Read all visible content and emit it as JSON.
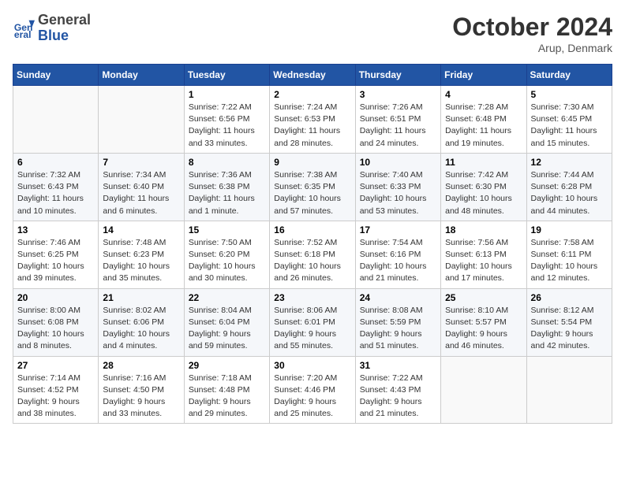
{
  "logo": {
    "line1": "General",
    "line2": "Blue"
  },
  "title": "October 2024",
  "subtitle": "Arup, Denmark",
  "days_of_week": [
    "Sunday",
    "Monday",
    "Tuesday",
    "Wednesday",
    "Thursday",
    "Friday",
    "Saturday"
  ],
  "weeks": [
    [
      {
        "day": "",
        "detail": ""
      },
      {
        "day": "",
        "detail": ""
      },
      {
        "day": "1",
        "detail": "Sunrise: 7:22 AM\nSunset: 6:56 PM\nDaylight: 11 hours\nand 33 minutes."
      },
      {
        "day": "2",
        "detail": "Sunrise: 7:24 AM\nSunset: 6:53 PM\nDaylight: 11 hours\nand 28 minutes."
      },
      {
        "day": "3",
        "detail": "Sunrise: 7:26 AM\nSunset: 6:51 PM\nDaylight: 11 hours\nand 24 minutes."
      },
      {
        "day": "4",
        "detail": "Sunrise: 7:28 AM\nSunset: 6:48 PM\nDaylight: 11 hours\nand 19 minutes."
      },
      {
        "day": "5",
        "detail": "Sunrise: 7:30 AM\nSunset: 6:45 PM\nDaylight: 11 hours\nand 15 minutes."
      }
    ],
    [
      {
        "day": "6",
        "detail": "Sunrise: 7:32 AM\nSunset: 6:43 PM\nDaylight: 11 hours\nand 10 minutes."
      },
      {
        "day": "7",
        "detail": "Sunrise: 7:34 AM\nSunset: 6:40 PM\nDaylight: 11 hours\nand 6 minutes."
      },
      {
        "day": "8",
        "detail": "Sunrise: 7:36 AM\nSunset: 6:38 PM\nDaylight: 11 hours\nand 1 minute."
      },
      {
        "day": "9",
        "detail": "Sunrise: 7:38 AM\nSunset: 6:35 PM\nDaylight: 10 hours\nand 57 minutes."
      },
      {
        "day": "10",
        "detail": "Sunrise: 7:40 AM\nSunset: 6:33 PM\nDaylight: 10 hours\nand 53 minutes."
      },
      {
        "day": "11",
        "detail": "Sunrise: 7:42 AM\nSunset: 6:30 PM\nDaylight: 10 hours\nand 48 minutes."
      },
      {
        "day": "12",
        "detail": "Sunrise: 7:44 AM\nSunset: 6:28 PM\nDaylight: 10 hours\nand 44 minutes."
      }
    ],
    [
      {
        "day": "13",
        "detail": "Sunrise: 7:46 AM\nSunset: 6:25 PM\nDaylight: 10 hours\nand 39 minutes."
      },
      {
        "day": "14",
        "detail": "Sunrise: 7:48 AM\nSunset: 6:23 PM\nDaylight: 10 hours\nand 35 minutes."
      },
      {
        "day": "15",
        "detail": "Sunrise: 7:50 AM\nSunset: 6:20 PM\nDaylight: 10 hours\nand 30 minutes."
      },
      {
        "day": "16",
        "detail": "Sunrise: 7:52 AM\nSunset: 6:18 PM\nDaylight: 10 hours\nand 26 minutes."
      },
      {
        "day": "17",
        "detail": "Sunrise: 7:54 AM\nSunset: 6:16 PM\nDaylight: 10 hours\nand 21 minutes."
      },
      {
        "day": "18",
        "detail": "Sunrise: 7:56 AM\nSunset: 6:13 PM\nDaylight: 10 hours\nand 17 minutes."
      },
      {
        "day": "19",
        "detail": "Sunrise: 7:58 AM\nSunset: 6:11 PM\nDaylight: 10 hours\nand 12 minutes."
      }
    ],
    [
      {
        "day": "20",
        "detail": "Sunrise: 8:00 AM\nSunset: 6:08 PM\nDaylight: 10 hours\nand 8 minutes."
      },
      {
        "day": "21",
        "detail": "Sunrise: 8:02 AM\nSunset: 6:06 PM\nDaylight: 10 hours\nand 4 minutes."
      },
      {
        "day": "22",
        "detail": "Sunrise: 8:04 AM\nSunset: 6:04 PM\nDaylight: 9 hours\nand 59 minutes."
      },
      {
        "day": "23",
        "detail": "Sunrise: 8:06 AM\nSunset: 6:01 PM\nDaylight: 9 hours\nand 55 minutes."
      },
      {
        "day": "24",
        "detail": "Sunrise: 8:08 AM\nSunset: 5:59 PM\nDaylight: 9 hours\nand 51 minutes."
      },
      {
        "day": "25",
        "detail": "Sunrise: 8:10 AM\nSunset: 5:57 PM\nDaylight: 9 hours\nand 46 minutes."
      },
      {
        "day": "26",
        "detail": "Sunrise: 8:12 AM\nSunset: 5:54 PM\nDaylight: 9 hours\nand 42 minutes."
      }
    ],
    [
      {
        "day": "27",
        "detail": "Sunrise: 7:14 AM\nSunset: 4:52 PM\nDaylight: 9 hours\nand 38 minutes."
      },
      {
        "day": "28",
        "detail": "Sunrise: 7:16 AM\nSunset: 4:50 PM\nDaylight: 9 hours\nand 33 minutes."
      },
      {
        "day": "29",
        "detail": "Sunrise: 7:18 AM\nSunset: 4:48 PM\nDaylight: 9 hours\nand 29 minutes."
      },
      {
        "day": "30",
        "detail": "Sunrise: 7:20 AM\nSunset: 4:46 PM\nDaylight: 9 hours\nand 25 minutes."
      },
      {
        "day": "31",
        "detail": "Sunrise: 7:22 AM\nSunset: 4:43 PM\nDaylight: 9 hours\nand 21 minutes."
      },
      {
        "day": "",
        "detail": ""
      },
      {
        "day": "",
        "detail": ""
      }
    ]
  ]
}
